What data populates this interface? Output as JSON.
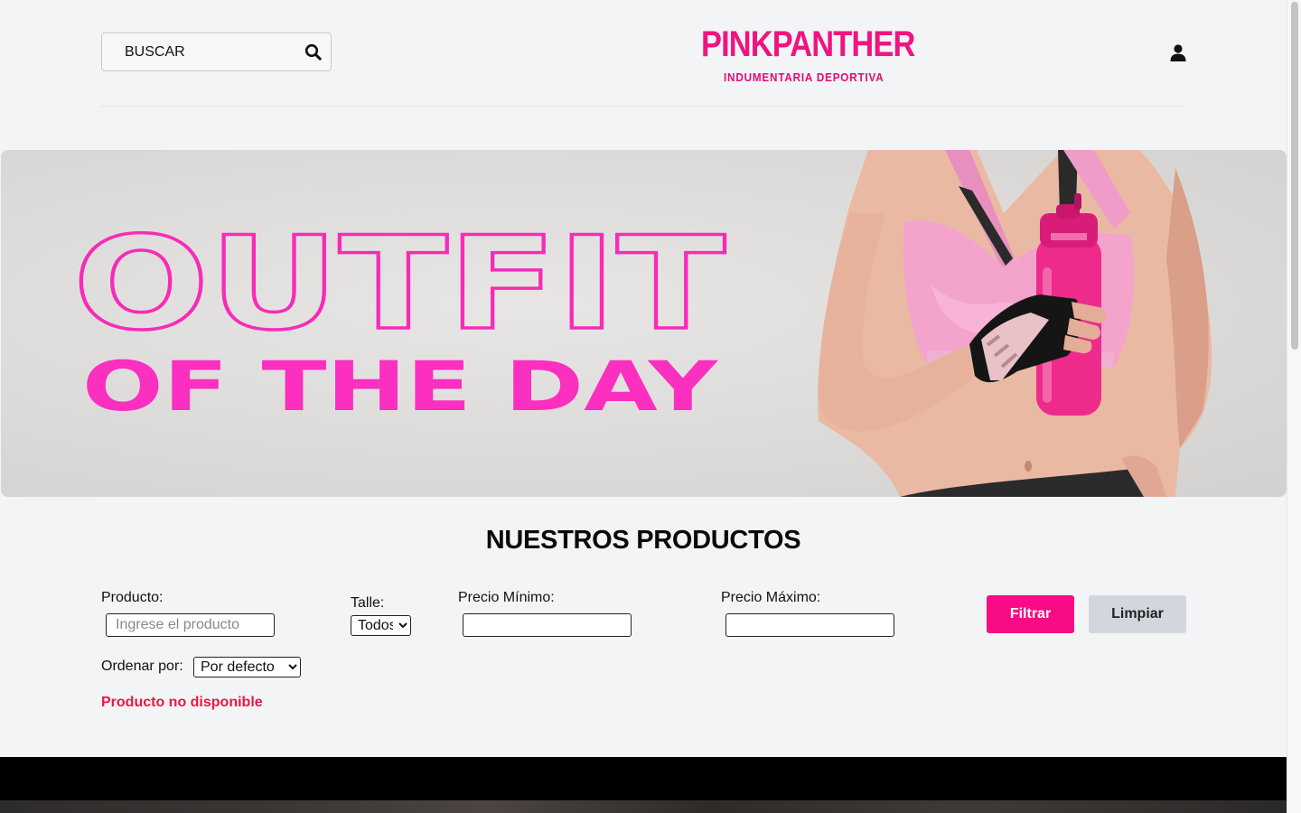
{
  "header": {
    "search_placeholder": "BUSCAR",
    "logo_text": "PINKPANTHER",
    "logo_subtitle": "INDUMENTARIA DEPORTIVA",
    "search_icon": "search-icon",
    "user_icon": "user-icon"
  },
  "banner": {
    "headline": "OUTFIT",
    "subheadline": "OF THE DAY"
  },
  "products": {
    "title": "NUESTROS PRODUCTOS",
    "filters": {
      "producto_label": "Producto:",
      "producto_placeholder": "Ingrese el producto",
      "producto_value": "",
      "talle_label": "Talle:",
      "talle_selected": "Todos",
      "precio_min_label": "Precio Mínimo:",
      "precio_min_value": "",
      "precio_max_label": "Precio Máximo:",
      "precio_max_value": "",
      "ordenar_label": "Ordenar por:",
      "ordenar_selected": "Por defecto",
      "filtrar_button": "Filtrar",
      "limpiar_button": "Limpiar"
    },
    "status_message": "Producto no disponible"
  },
  "colors": {
    "brand_pink": "#f0147f",
    "button_pink": "#f80b84",
    "error_red": "#ee1642",
    "page_bg": "#f3f4f6"
  }
}
